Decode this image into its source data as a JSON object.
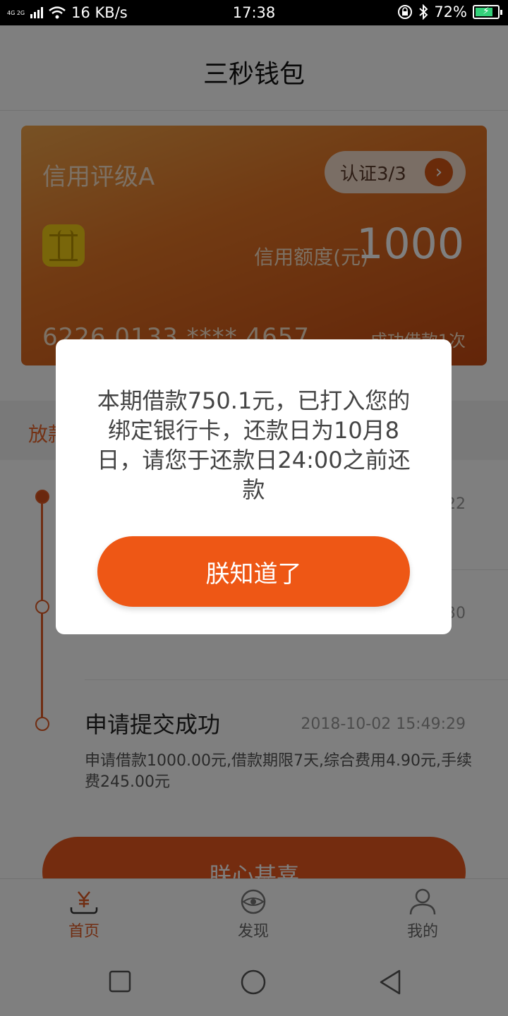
{
  "status_bar": {
    "network_type": "4G\n2G",
    "speed": "16 KB/s",
    "time": "17:38",
    "battery": "72%"
  },
  "header": {
    "title": "三秒钱包"
  },
  "card": {
    "rating": "信用评级A",
    "auth_label": "认证3/3",
    "limit_label": "信用额度(元)",
    "limit_value": "1000",
    "card_number": "6226 0133 **** 4657",
    "success_text": "成功借款1次"
  },
  "section": {
    "label": "放款"
  },
  "timeline": {
    "items": [
      {
        "time": "22"
      },
      {
        "time": "30"
      },
      {
        "title": "申请提交成功",
        "time": "2018-10-02 15:49:29",
        "desc": "申请借款1000.00元,借款期限7天,综合费用4.90元,手续费245.00元"
      }
    ]
  },
  "main_button": {
    "label": "朕心甚喜"
  },
  "tabbar": {
    "items": [
      {
        "label": "首页"
      },
      {
        "label": "发现"
      },
      {
        "label": "我的"
      }
    ]
  },
  "modal": {
    "message": "本期借款750.1元，已打入您的绑定银行卡，还款日为10月8日，请您于还款日24:00之前还款",
    "ok_label": "朕知道了"
  },
  "colors": {
    "accent": "#ee5715",
    "card_start": "#f0a44a",
    "card_end": "#c64a12"
  }
}
